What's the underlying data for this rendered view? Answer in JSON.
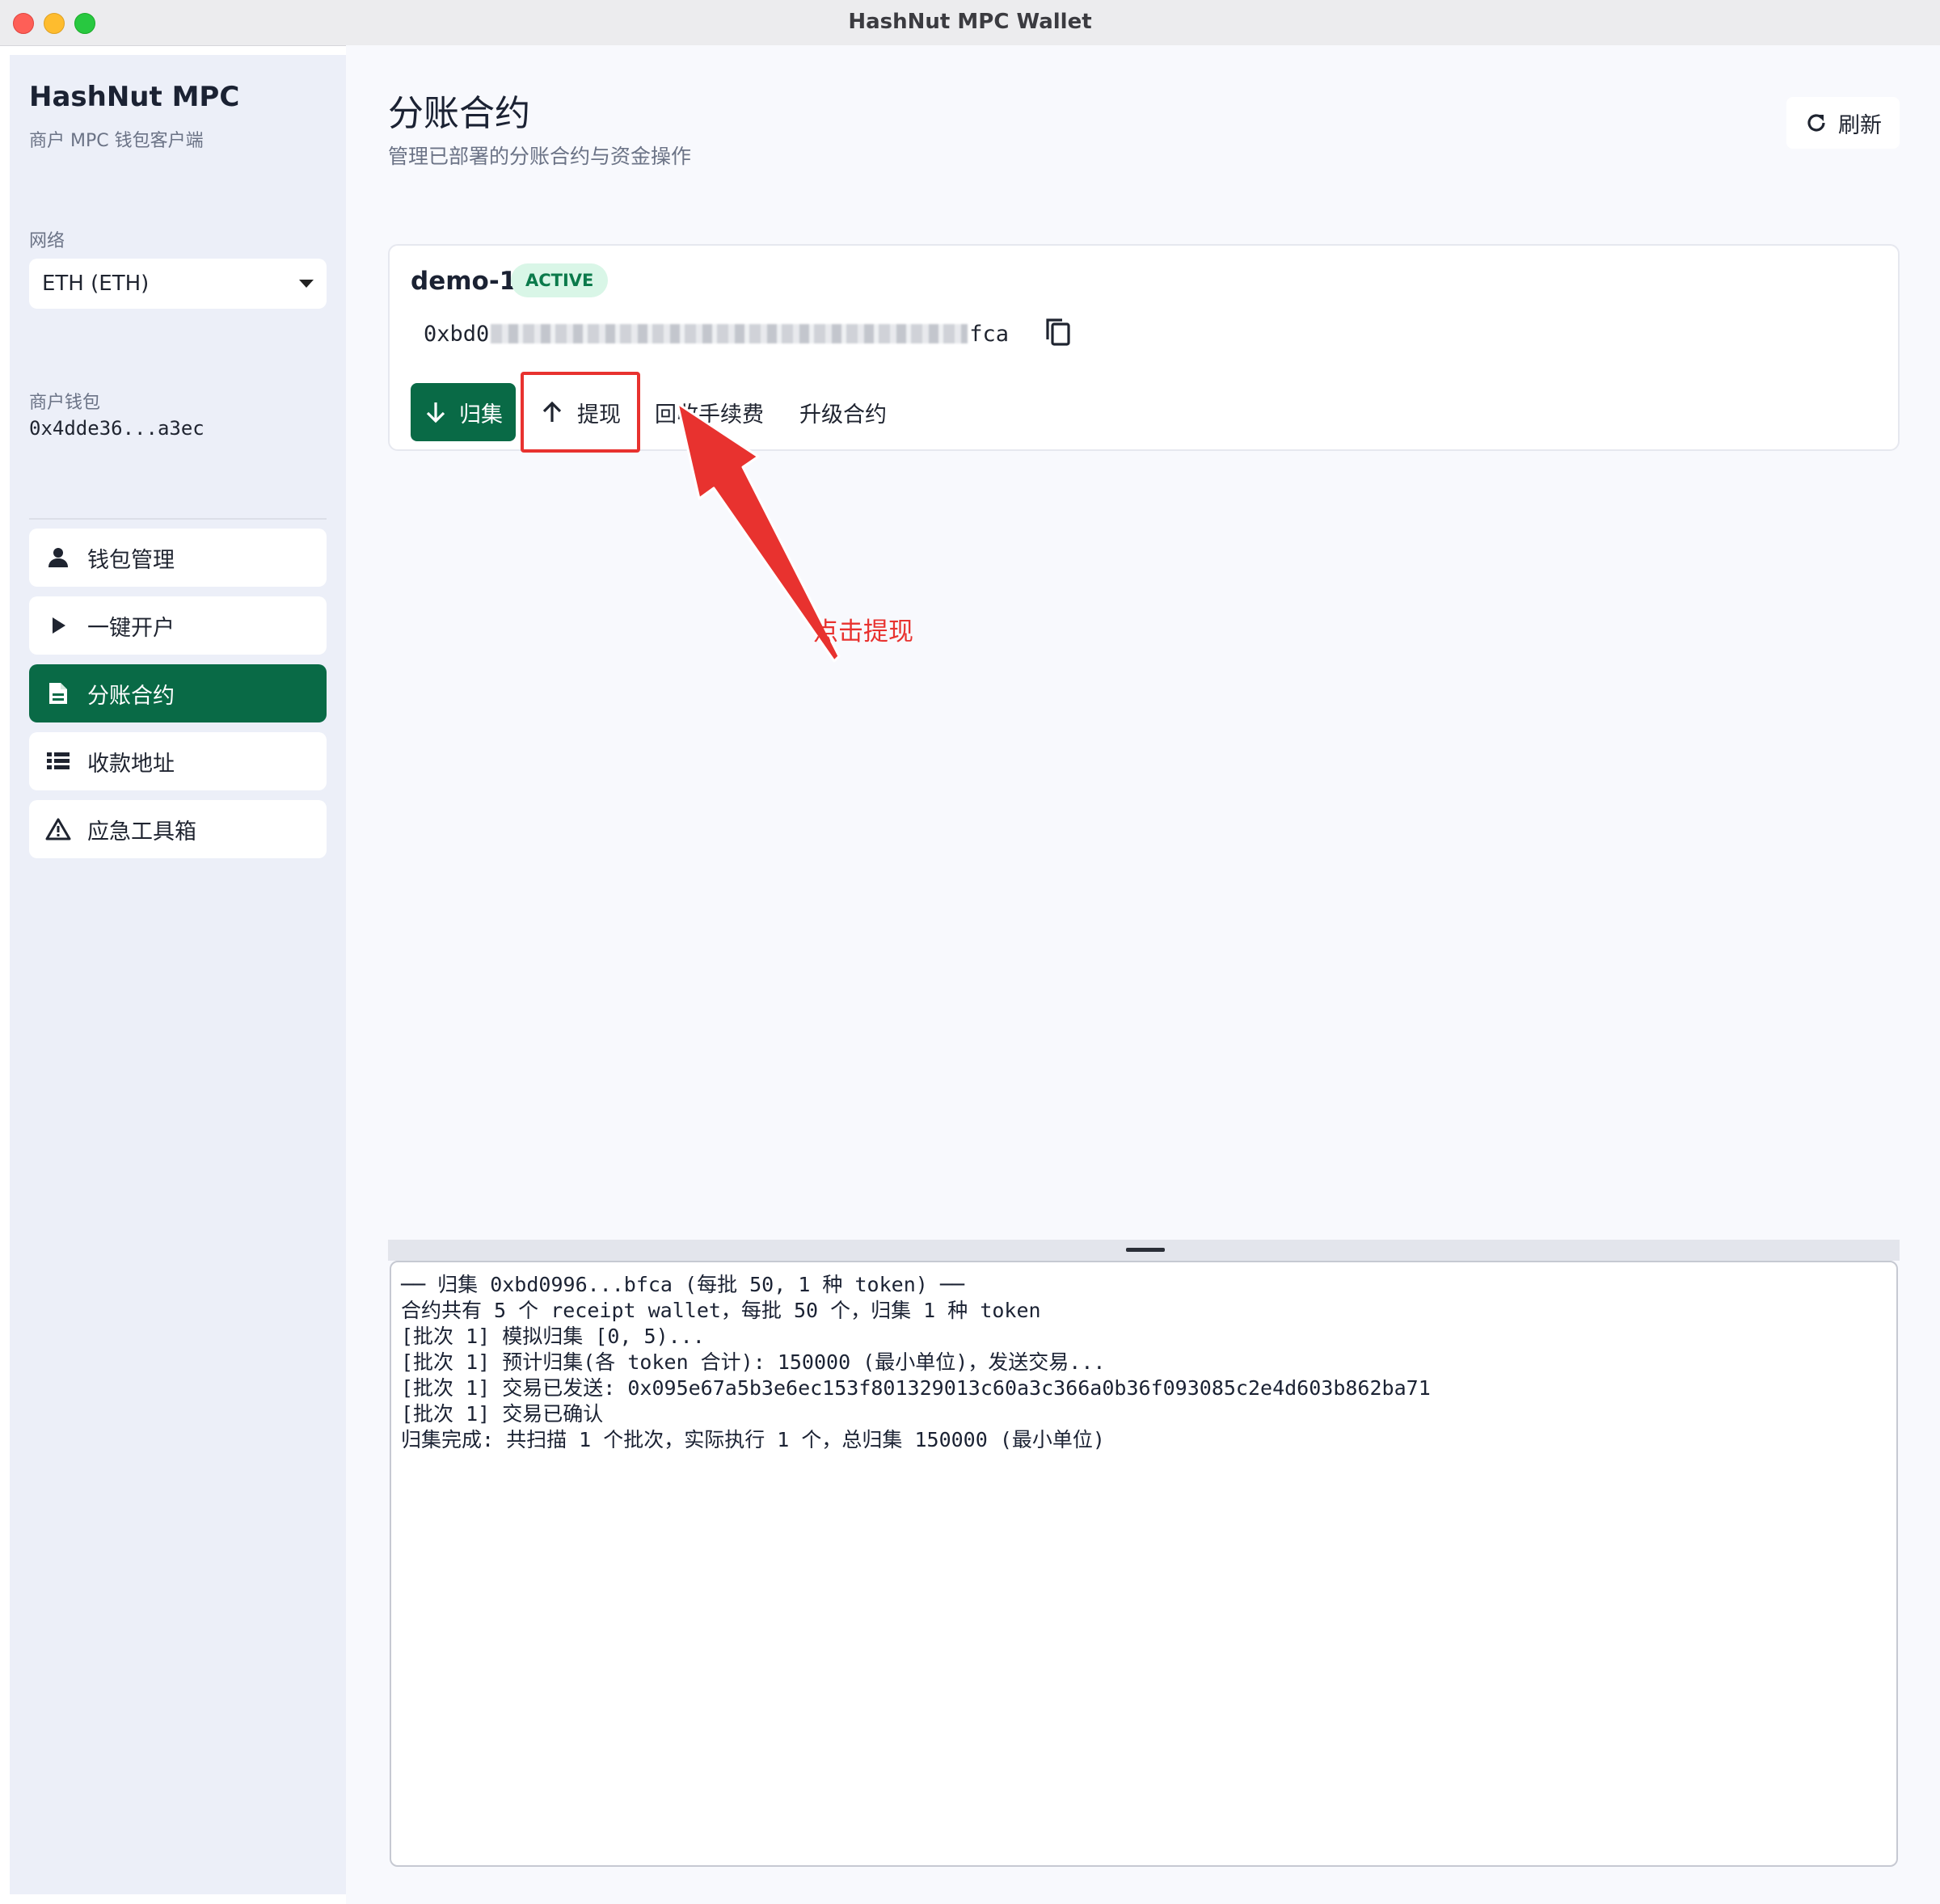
{
  "window": {
    "title": "HashNut MPC Wallet"
  },
  "sidebar": {
    "brand": "HashNut MPC",
    "brand_sub": "商户 MPC 钱包客户端",
    "network_label": "网络",
    "network_value": "ETH (ETH)",
    "wallet_label": "商户钱包",
    "wallet_address": "0x4dde36...a3ec",
    "items": [
      {
        "label": "钱包管理",
        "icon": "user-icon",
        "active": false
      },
      {
        "label": "一键开户",
        "icon": "play-icon",
        "active": false
      },
      {
        "label": "分账合约",
        "icon": "document-icon",
        "active": true
      },
      {
        "label": "收款地址",
        "icon": "list-icon",
        "active": false
      },
      {
        "label": "应急工具箱",
        "icon": "warning-icon",
        "active": false
      }
    ]
  },
  "main": {
    "title": "分账合约",
    "subtitle": "管理已部署的分账合约与资金操作",
    "refresh_label": "刷新",
    "contract": {
      "name": "demo-1",
      "status": "ACTIVE",
      "address_prefix": "0xbd0",
      "address_suffix": "fca",
      "actions": {
        "collect": "归集",
        "withdraw": "提现",
        "reclaim_fee": "回收手续费",
        "upgrade": "升级合约"
      }
    },
    "annotation": "点击提现"
  },
  "log": {
    "lines": [
      "── 归集 0xbd0996...bfca (每批 50, 1 种 token) ──",
      "合约共有 5 个 receipt wallet，每批 50 个，归集 1 种 token",
      "[批次 1] 模拟归集 [0, 5)...",
      "[批次 1] 预计归集(各 token 合计): 150000 (最小单位)，发送交易...",
      "[批次 1] 交易已发送: 0x095e67a5b3e6ec153f801329013c60a3c366a0b36f093085c2e4d603b862ba71",
      "[批次 1] 交易已确认",
      "归集完成: 共扫描 1 个批次，实际执行 1 个，总归集 150000 (最小单位)"
    ]
  },
  "colors": {
    "accent": "#096a46",
    "badge_bg": "#d9f6e7",
    "badge_text": "#0b7a4b",
    "annotation": "#e8322f"
  }
}
